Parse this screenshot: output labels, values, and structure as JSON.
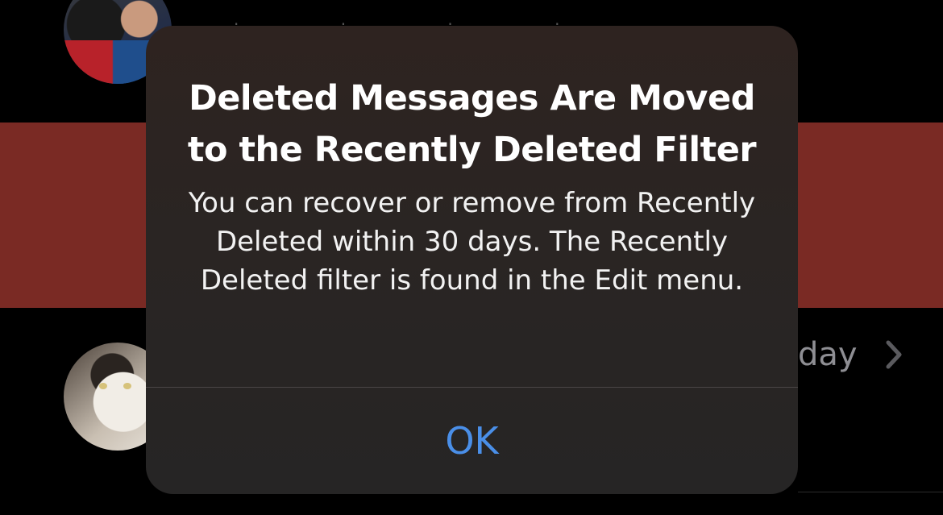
{
  "list": {
    "row_meta_text": "day"
  },
  "alert": {
    "title": "Deleted Messages Are Moved to the Recently Deleted Filter",
    "message": "You can recover or remove from Recently Deleted within 30 days. The Recently Deleted filter is found in the Edit menu.",
    "ok_label": "OK"
  },
  "colors": {
    "swipe_action_red": "#7a2a24",
    "alert_background": "#2a2523",
    "button_blue": "#4a8fe8",
    "secondary_text": "#8e8e93"
  },
  "icons": {
    "delete_action": "trash-icon",
    "row_disclosure": "chevron-right-icon"
  }
}
